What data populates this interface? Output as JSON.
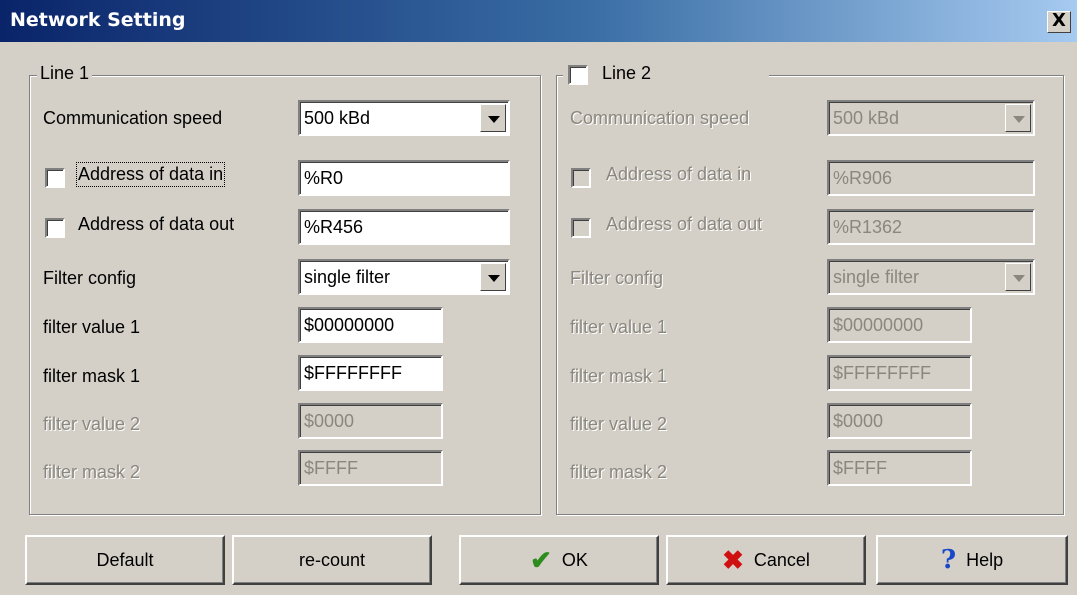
{
  "window": {
    "title": "Network Setting",
    "close_label": "X"
  },
  "line1": {
    "title": "Line 1",
    "speed_label": "Communication speed",
    "speed_value": "500 kBd",
    "addr_in_label": "Address of data in",
    "addr_in_value": "%R0",
    "addr_out_label": "Address of data out",
    "addr_out_value": "%R456",
    "filter_config_label": "Filter config",
    "filter_config_value": "single filter",
    "fv1_label": "filter value 1",
    "fv1_value": "$00000000",
    "fm1_label": "filter mask 1",
    "fm1_value": "$FFFFFFFF",
    "fv2_label": "filter value 2",
    "fv2_value": "$0000",
    "fm2_label": "filter mask 2",
    "fm2_value": "$FFFF"
  },
  "line2": {
    "title": "Line 2",
    "speed_label": "Communication speed",
    "speed_value": "500 kBd",
    "addr_in_label": "Address of data in",
    "addr_in_value": "%R906",
    "addr_out_label": "Address of data out",
    "addr_out_value": "%R1362",
    "filter_config_label": "Filter config",
    "filter_config_value": "single filter",
    "fv1_label": "filter value 1",
    "fv1_value": "$00000000",
    "fm1_label": "filter mask 1",
    "fm1_value": "$FFFFFFFF",
    "fv2_label": "filter value 2",
    "fv2_value": "$0000",
    "fm2_label": "filter mask 2",
    "fm2_value": "$FFFF"
  },
  "buttons": {
    "default": "Default",
    "recount": "re-count",
    "ok": "OK",
    "ok_icon": "checkmark-icon",
    "cancel": "Cancel",
    "cancel_icon": "red-x-icon",
    "help": "Help",
    "help_icon": "question-mark-icon"
  },
  "colors": {
    "ok_icon": "#2e8b1e",
    "cancel_icon": "#d01010",
    "help_icon": "#1848c8",
    "disabled_text": "#8a877f"
  }
}
